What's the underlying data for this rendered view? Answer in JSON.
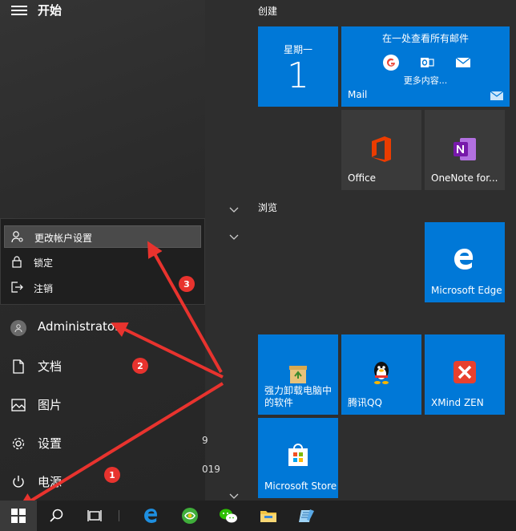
{
  "start": {
    "title": "开始",
    "nav": {
      "user": "Administrator",
      "documents": "文档",
      "pictures": "图片",
      "settings": "设置",
      "power": "电源"
    },
    "account_menu": {
      "change_account_settings": "更改帐户设置",
      "lock": "锁定",
      "sign_out": "注销"
    },
    "list_partials": [
      "9",
      "019"
    ]
  },
  "tiles": {
    "group_create": "创建",
    "group_browse": "浏览",
    "calendar": {
      "day": "星期一",
      "date": "1"
    },
    "mail": {
      "headline": "在一处查看所有邮件",
      "more": "更多内容...",
      "label": "Mail"
    },
    "office": "Office",
    "onenote": "OneNote for...",
    "edge": "Microsoft Edge",
    "uninstaller": "强力卸载电脑中\n的软件",
    "qq": "腾讯QQ",
    "xmind": "XMind ZEN",
    "store": "Microsoft Store"
  },
  "annotations": {
    "step1": "1",
    "step2": "2",
    "step3": "3"
  },
  "colors": {
    "tile_blue": "#0078d7",
    "badge_red": "#e8332e",
    "arrow_red": "#e8332e",
    "taskbar": "#202020"
  }
}
